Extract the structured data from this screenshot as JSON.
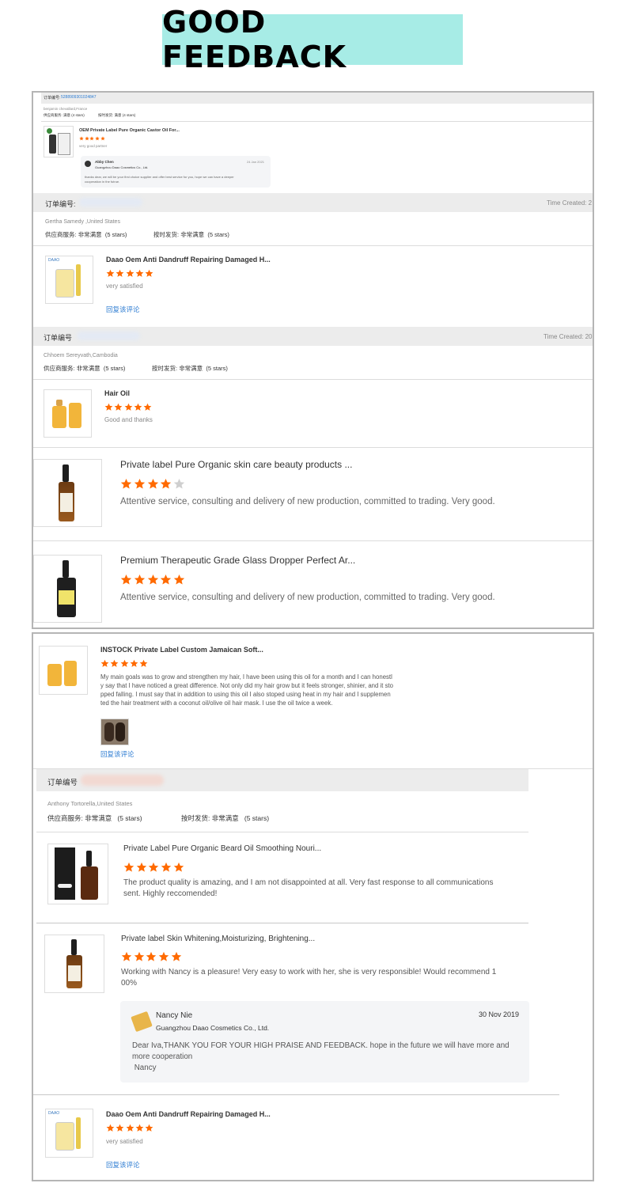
{
  "banner": {
    "title": "GOOD   FEEDBACK"
  },
  "order1": {
    "order_label": "订单编号:",
    "order_no": "5288909301024847",
    "buyer": "benjamin chevallard,France",
    "service_label": "供应商服务:",
    "service_value": "满意",
    "service_stars": "(4 stars)",
    "ship_label": "按时发货:",
    "ship_value": "满意",
    "ship_stars": "(4 stars)",
    "product": "OEM Private Label Pure Organic Castor Oil For...",
    "rating": 5,
    "comment": "very good partner",
    "reply": {
      "name": "Abby Chen",
      "company": "Guangzhou Daao Cosmetics Co., Ltd.",
      "date": "24 Jan 2021",
      "text_line1": "thanks dear, we will be your first choice supplier and offer best service for you, hope we can have a deeper",
      "text_line2": "cooperation in the futrue."
    }
  },
  "order2": {
    "order_label": "订单编号:",
    "time_label": "Time Created: 2",
    "buyer": "Gertha Samedy ,United States",
    "service_label": "供应商服务:",
    "service_value": "非常满意",
    "service_stars": "(5 stars)",
    "ship_label": "按时发货:",
    "ship_value": "非常满意",
    "ship_stars": "(5 stars)",
    "product": "Daao Oem Anti Dandruff Repairing Damaged H...",
    "rating": 5,
    "comment": "very satisfied",
    "reply_link": "回复该评论"
  },
  "order3": {
    "order_label": "订单编号",
    "time_label": "Time Created: 20",
    "buyer": "Chhoem Sereyvath,Cambodia",
    "service_label": "供应商服务:",
    "service_value": "非常满意",
    "service_stars": "(5 stars)",
    "ship_label": "按时发货:",
    "ship_value": "非常满意",
    "ship_stars": "(5 stars)",
    "product": "Hair Oil",
    "rating": 5,
    "comment": "Good and thanks"
  },
  "item4": {
    "product": "Private label Pure Organic skin care beauty products ...",
    "rating": 4,
    "comment": "Attentive service, consulting and delivery of new production, committed to trading. Very good."
  },
  "item5": {
    "product": "Premium Therapeutic Grade Glass Dropper Perfect Ar...",
    "rating": 5,
    "comment": "Attentive service, consulting and delivery of new production, committed to trading. Very good."
  },
  "item6": {
    "product": "INSTOCK Private Label Custom Jamaican Soft...",
    "rating": 5,
    "comment_lines": [
      "My main goals was to grow and strengthen my hair, I have been using this oil for a month and I can honestl",
      "y say that I have noticed a great difference. Not only did my hair grow but it feels stronger, shinier, and it sto",
      "pped falling. I must say that in addition to using this oil I also stoped using heat in my hair and I supplemen",
      "ted the hair treatment with a coconut oil/olive oil hair mask. I use the oil twice a week."
    ],
    "reply_link": "回复该评论"
  },
  "order7": {
    "order_label": "订单编号",
    "buyer": "Anthony Tortorella,United States",
    "service_label": "供应商服务:",
    "service_value": "非常满意",
    "service_stars": "(5 stars)",
    "ship_label": "按时发货:",
    "ship_value": "非常满意",
    "ship_stars": "(5 stars)"
  },
  "item7": {
    "product": "Private Label Pure Organic Beard Oil Smoothing Nouri...",
    "rating": 5,
    "comment_lines": [
      "The product quality is amazing, and I am not disappointed at all. Very fast response to all communications",
      "sent. Highly reccomended!"
    ]
  },
  "item8": {
    "product": "Private label Skin Whitening,Moisturizing, Brightening...",
    "rating": 5,
    "comment_lines": [
      "Working with Nancy is a pleasure! Very easy to work with her, she is very responsible! Would recommend 1",
      "00%"
    ],
    "reply": {
      "name": "Nancy Nie",
      "company": "Guangzhou Daao Cosmetics Co., Ltd.",
      "date": "30 Nov 2019",
      "text_lines": [
        "Dear Iva,THANK YOU FOR YOUR HIGH PRAISE AND FEEDBACK. hope in the future we will have more and",
        "more cooperation",
        " Nancy"
      ]
    }
  },
  "item9": {
    "product": "Daao Oem Anti Dandruff Repairing Damaged H...",
    "rating": 5,
    "comment": "very satisfied",
    "reply_link": "回复该评论"
  },
  "colors": {
    "star": "#ff6a00",
    "star_empty": "#cfcfcf",
    "link": "#2d7cd2",
    "banner": "#a7ece6"
  }
}
